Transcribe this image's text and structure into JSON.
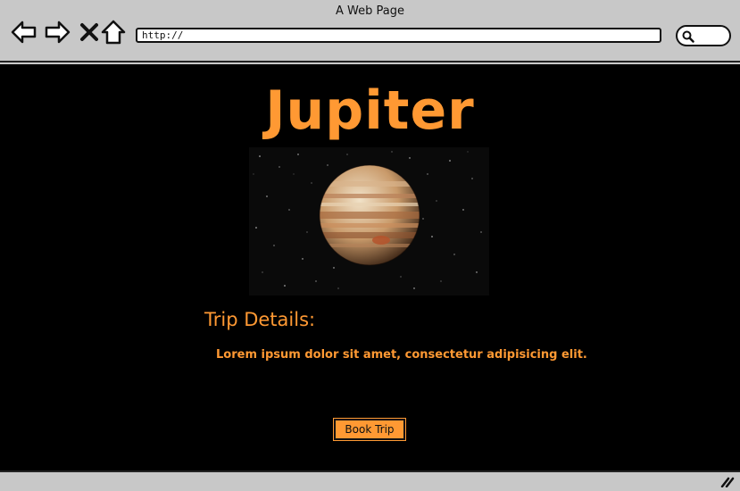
{
  "window": {
    "title": "A Web Page"
  },
  "browser": {
    "url": "http://",
    "nav": {
      "back_icon": "back-arrow-icon",
      "forward_icon": "forward-arrow-icon",
      "stop_icon": "close-icon",
      "home_icon": "home-icon"
    },
    "search_icon": "search-icon"
  },
  "page": {
    "title": "Jupiter",
    "image_subject": "jupiter-planet",
    "section_title": "Trip Details:",
    "body_text": "Lorem ipsum dolor sit amet, consectetur adipisicing elit.",
    "book_button_label": "Book Trip"
  },
  "colors": {
    "accent": "#ff9933",
    "page_background": "#000000",
    "chrome": "#c8c8c8"
  }
}
